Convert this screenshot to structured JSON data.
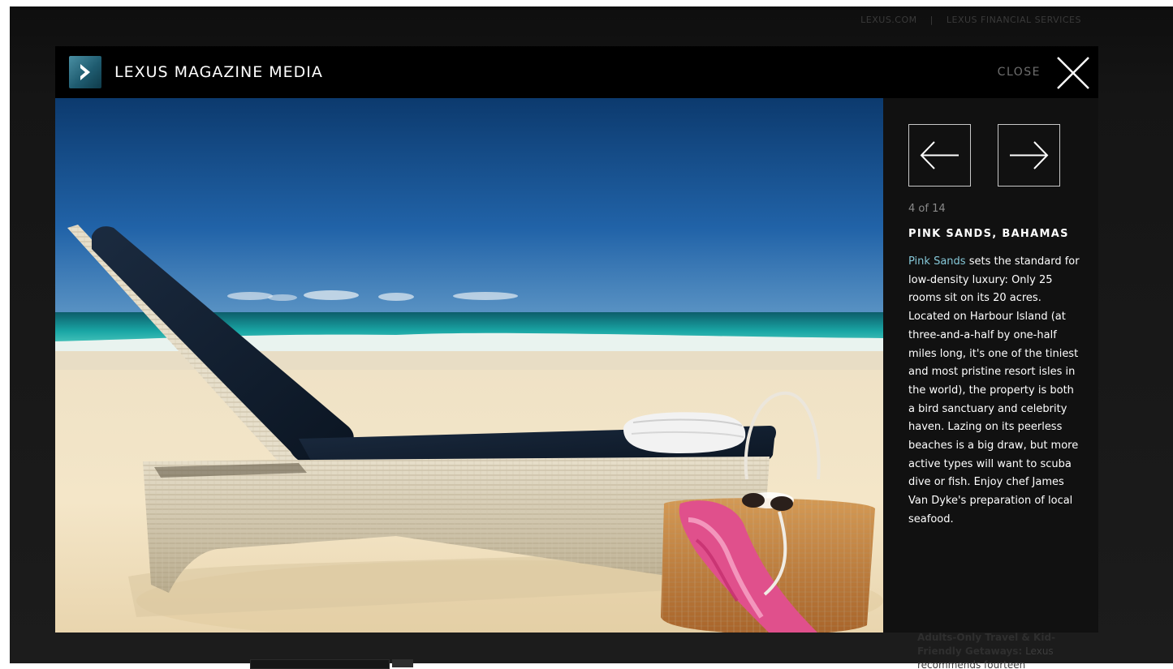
{
  "header_links": {
    "lexus": "LEXUS.COM",
    "separator": "|",
    "financial": "LEXUS FINANCIAL SERVICES"
  },
  "modal": {
    "title": "LEXUS MAGAZINE MEDIA",
    "close_label": "CLOSE",
    "logo_icon": "play-arrow-icon",
    "close_icon": "close-x-icon"
  },
  "gallery": {
    "counter": "4 of 14",
    "prev_icon": "arrow-left-icon",
    "next_icon": "arrow-right-icon",
    "photo_title": "PINK SANDS, BAHAMAS",
    "description_link": "Pink Sands",
    "description_text": " sets the standard for low-density luxury: Only 25 rooms sit on its 20 acres. Located on Harbour Island (at three-and-a-half by one-half miles long, it's one of the tiniest and most pristine resort isles in the world), the property is both a bird sanctuary and celebrity haven. Lazing on its peerless beaches is a big draw, but more active types will want to scuba dive or fish. Enjoy chef James Van Dyke's preparation of local seafood."
  },
  "background_page": {
    "sidebar_heading": "Adults-Only Travel & Kid-Friendly Getaways:",
    "sidebar_snippet": " Lexus recommends fourteen"
  },
  "colors": {
    "accent_link": "#86c8d8",
    "logo_teal": "#2b6f84"
  }
}
